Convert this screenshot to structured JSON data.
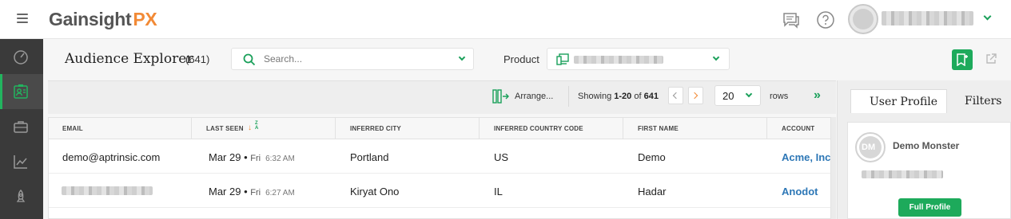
{
  "app": {
    "logo_main": "Gainsight",
    "logo_accent": "PX",
    "brand_color": "#1daa5b",
    "accent_color": "#f28a36"
  },
  "header": {
    "user_name_hidden": true
  },
  "nav": {
    "items": [
      "speedometer-icon",
      "audience-icon",
      "briefcase-icon",
      "chart-icon",
      "rocket-icon"
    ],
    "active_index": 1
  },
  "page": {
    "title": "Audience Explorer",
    "count": "(641)"
  },
  "search": {
    "placeholder": "Search..."
  },
  "product": {
    "label": "Product"
  },
  "toolbar": {
    "arrange_label": "Arrange...",
    "showing_prefix": "Showing",
    "range": "1-20",
    "of_label": "of",
    "total": "641",
    "rows_value": "20",
    "rows_label": "rows"
  },
  "table": {
    "columns": [
      "EMAIL",
      "LAST SEEN",
      "INFERRED CITY",
      "INFERRED COUNTRY CODE",
      "FIRST NAME",
      "ACCOUNT"
    ],
    "rows": [
      {
        "email": "demo@aptrinsic.com",
        "date": "Mar 29",
        "dow": "Fri",
        "time": "6:32 AM",
        "city": "Portland",
        "country": "US",
        "first_name": "Demo",
        "account": "Acme, Inc."
      },
      {
        "email": "",
        "date": "Mar 29",
        "dow": "Fri",
        "time": "6:27 AM",
        "city": "Kiryat Ono",
        "country": "IL",
        "first_name": "Hadar",
        "account": "Anodot"
      }
    ]
  },
  "panel": {
    "tabs": [
      "User Profile",
      "Filters"
    ],
    "active_tab": 0,
    "initials": "DM",
    "name": "Demo Monster",
    "button": "Full Profile"
  }
}
